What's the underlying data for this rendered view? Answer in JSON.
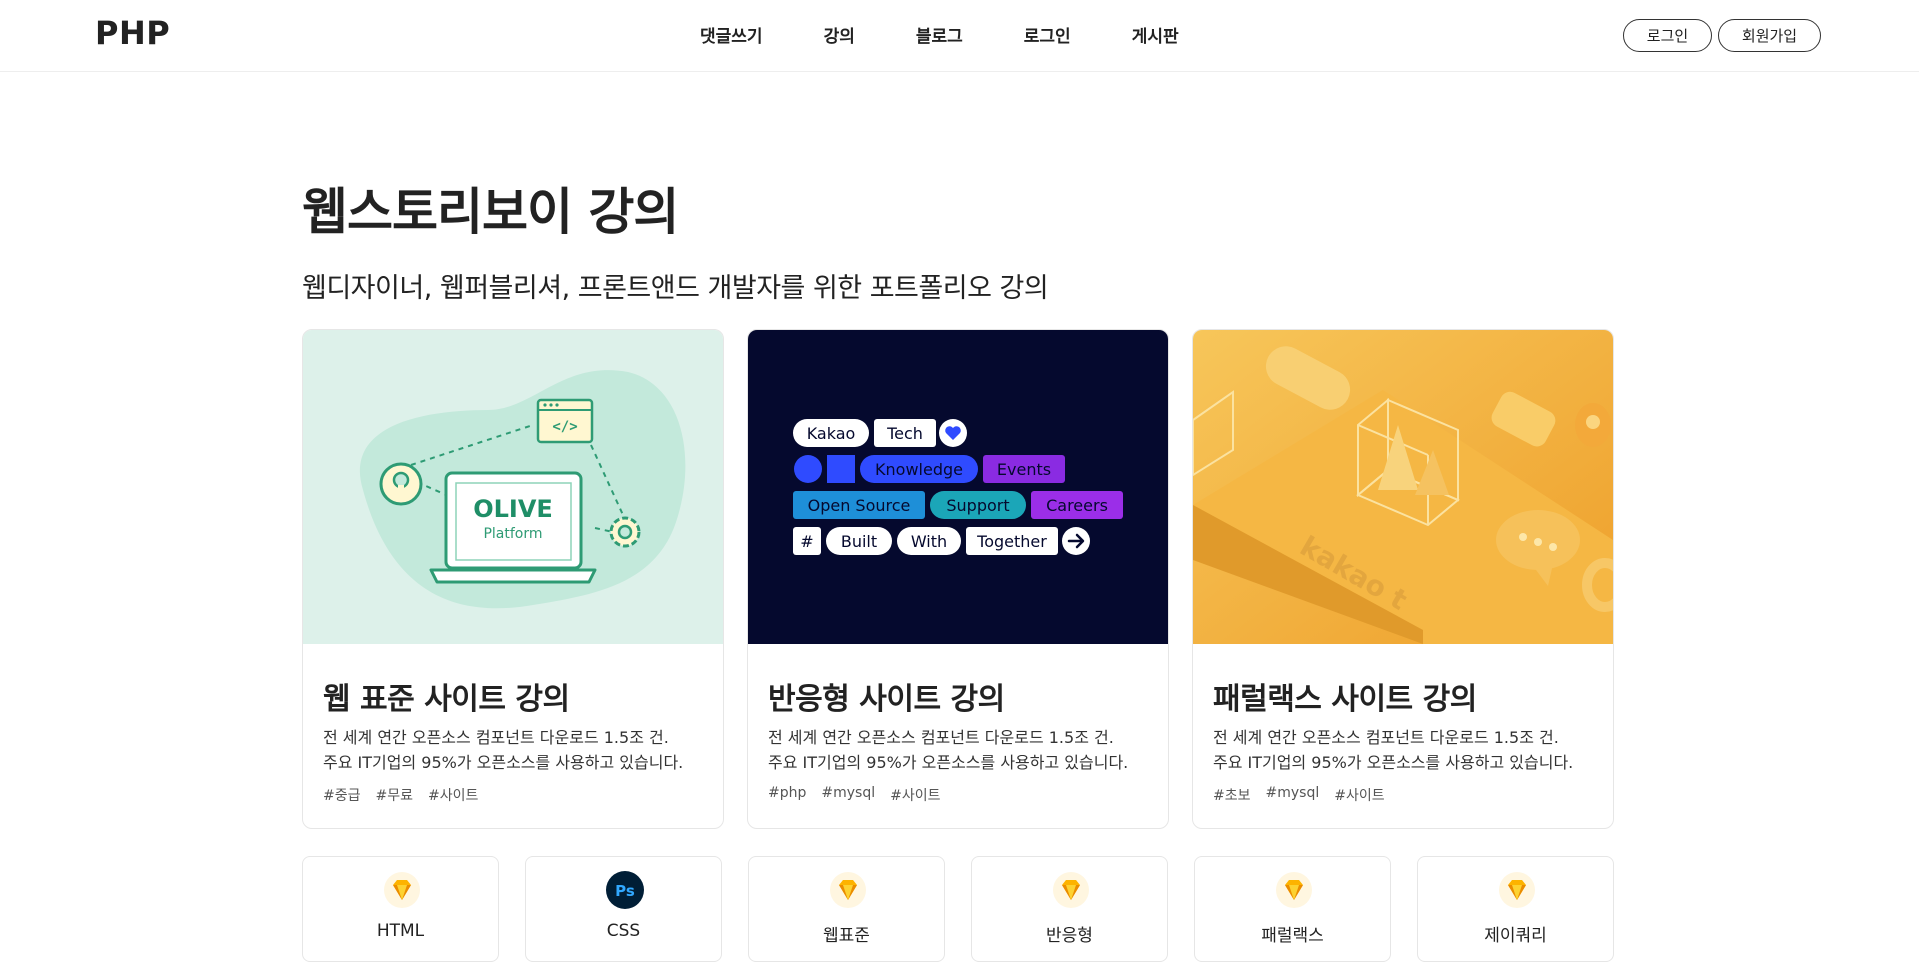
{
  "header": {
    "logo": "PHP",
    "nav": [
      "댓글쓰기",
      "강의",
      "블로그",
      "로그인",
      "게시판"
    ],
    "login_button": "로그인",
    "join_button": "회원가입"
  },
  "hero": {
    "title": "웹스토리보이 강의",
    "subtitle": "웹디자이너, 웹퍼블리셔, 프론트앤드 개발자를 위한 포트폴리오 강의"
  },
  "cards": [
    {
      "title": "웹 표준 사이트 강의",
      "desc_line1": "전 세계 연간 오픈소스 컴포넌트 다운로드 1.5조 건.",
      "desc_line2": "주요 IT기업의 95%가 오픈소스를 사용하고 있습니다.",
      "tags": [
        "#중급",
        "#무료",
        "#사이트"
      ],
      "image": {
        "bg_color": "#ddf1ea",
        "logo_line1": "OLIVE",
        "logo_line2": "Platform",
        "code_glyph": "</>"
      }
    },
    {
      "title": "반응형 사이트 강의",
      "desc_line1": "전 세계 연간 오픈소스 컴포넌트 다운로드 1.5조 건.",
      "desc_line2": "주요 IT기업의 95%가 오픈소스를 사용하고 있습니다.",
      "tags": [
        "#php",
        "#mysql",
        "#사이트"
      ],
      "image": {
        "bg_color": "#05092e",
        "chips": {
          "kakao": "Kakao",
          "tech": "Tech",
          "knowledge": "Knowledge",
          "events": "Events",
          "open_source": "Open Source",
          "support": "Support",
          "careers": "Careers",
          "hash": "#",
          "built": "Built",
          "with": "With",
          "together": "Together"
        }
      }
    },
    {
      "title": "패럴랙스 사이트 강의",
      "desc_line1": "전 세계 연간 오픈소스 컴포넌트 다운로드 1.5조 건.",
      "desc_line2": "주요 IT기업의 95%가 오픈소스를 사용하고 있습니다.",
      "tags": [
        "#초보",
        "#mysql",
        "#사이트"
      ],
      "image": {
        "bg_color": "#f3b13f",
        "brand_text": "kakao t"
      }
    }
  ],
  "categories": [
    {
      "label": "HTML",
      "icon": "sketch-gem-icon"
    },
    {
      "label": "CSS",
      "icon": "photoshop-icon",
      "icon_text": "Ps"
    },
    {
      "label": "웹표준",
      "icon": "sketch-gem-icon"
    },
    {
      "label": "반응형",
      "icon": "sketch-gem-icon"
    },
    {
      "label": "패럴랙스",
      "icon": "sketch-gem-icon"
    },
    {
      "label": "제이쿼리",
      "icon": "sketch-gem-icon"
    }
  ],
  "colors": {
    "text": "#222222",
    "border": "#e6e6e6",
    "gem_orange": "#fdb300",
    "ps_dark": "#001e36",
    "ps_blue": "#31a8ff"
  }
}
